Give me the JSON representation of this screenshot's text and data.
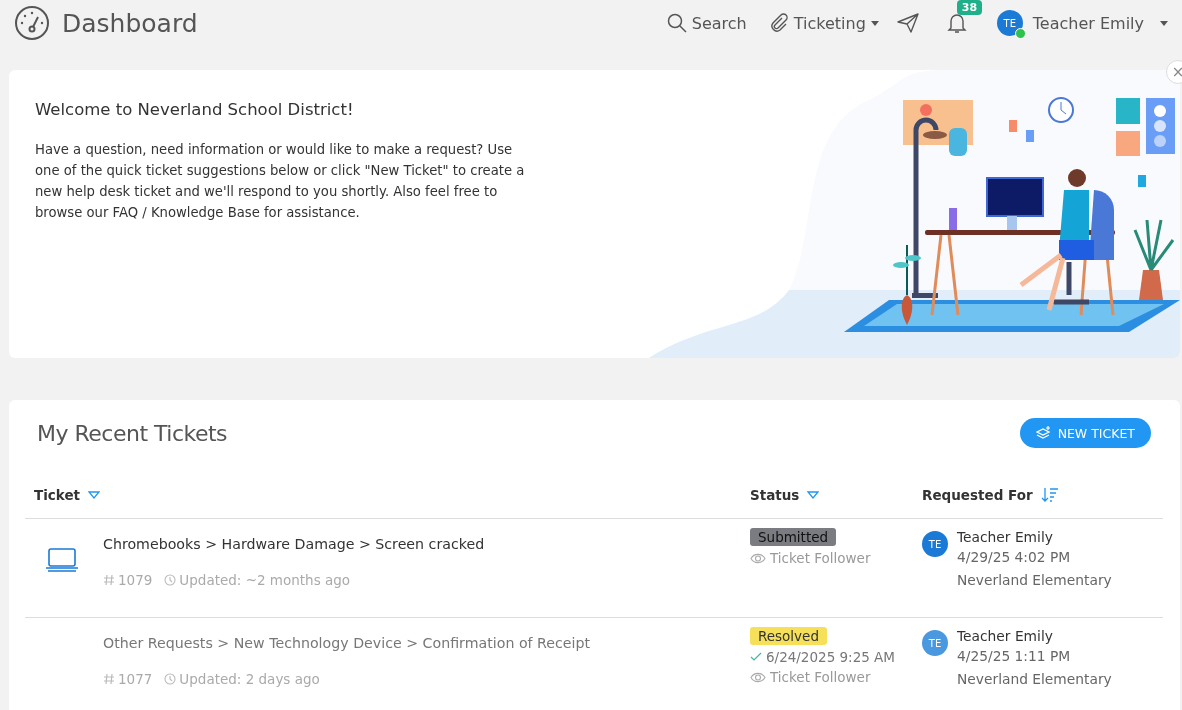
{
  "header": {
    "title": "Dashboard",
    "search": "Search",
    "menu": "Ticketing",
    "notifications": "38",
    "user": {
      "initials": "TE",
      "name": "Teacher Emily",
      "online": true
    }
  },
  "welcome": {
    "title": "Welcome to Neverland School District!",
    "text": "Have a question, need information or would like to make a request? Use one of the quick ticket suggestions below or click \"New Ticket\" to create a new help desk ticket and we'll respond to you shortly. Also feel free to browse our FAQ / Knowledge Base for assistance.",
    "close": "×"
  },
  "tickets": {
    "title": "My Recent Tickets",
    "new_button": "NEW TICKET",
    "columns": [
      {
        "label": "Ticket",
        "kind": "filter"
      },
      {
        "label": "Status",
        "kind": "filter"
      },
      {
        "label": "Requested For",
        "kind": "sort"
      }
    ],
    "rows": [
      {
        "device_icon": true,
        "unread": true,
        "title": "Chromebooks > Hardware Damage > Screen cracked",
        "number": "1079",
        "updated": "Updated: ~2 months ago",
        "status": {
          "label": "Submitted",
          "color": "#7a7c82"
        },
        "resolved": null,
        "follower": "Ticket Follower",
        "requester": {
          "initials": "TE",
          "color": "#1a7ad6",
          "name": "Teacher Emily",
          "date": "4/29/25 4:02 PM",
          "location": "Neverland Elementary"
        }
      },
      {
        "device_icon": false,
        "unread": false,
        "title": "Other Requests > New Technology Device > Confirmation of Receipt",
        "number": "1077",
        "updated": "Updated: 2 days ago",
        "status": {
          "label": "Resolved",
          "color": "#f6e05a"
        },
        "resolved": "6/24/2025 9:25 AM",
        "follower": "Ticket Follower",
        "requester": {
          "initials": "TE",
          "color": "#4a98e0",
          "name": "Teacher Emily",
          "date": "4/25/25 1:11 PM",
          "location": "Neverland Elementary"
        }
      }
    ]
  }
}
